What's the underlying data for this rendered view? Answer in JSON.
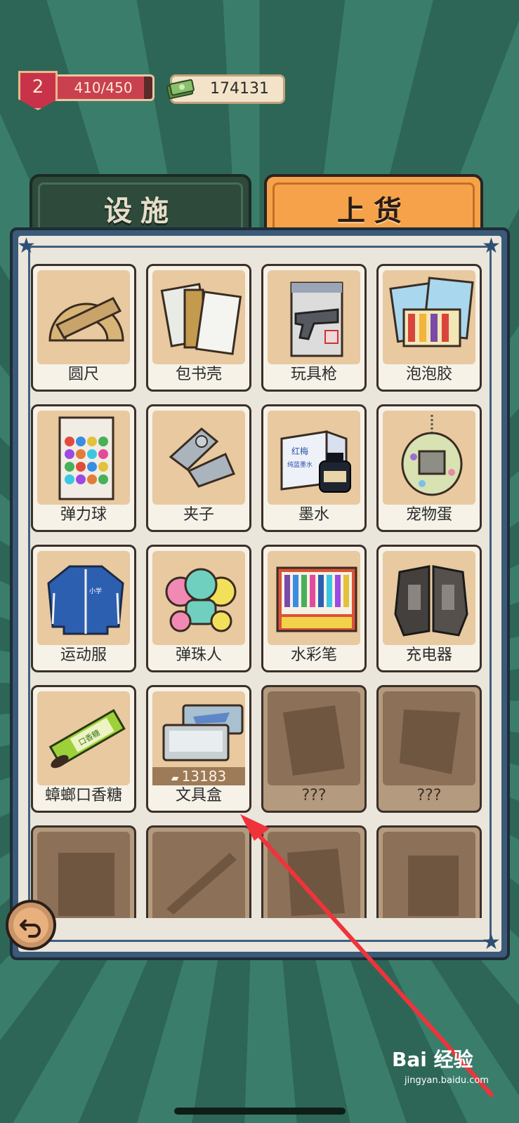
{
  "player": {
    "level": "2",
    "xp_text": "410/450",
    "xp_progress": 0.911,
    "cash": "174131"
  },
  "tabs": [
    {
      "label": "设施",
      "active": false
    },
    {
      "label": "上货",
      "active": true
    }
  ],
  "items": [
    {
      "name": "圆尺"
    },
    {
      "name": "包书壳"
    },
    {
      "name": "玩具枪"
    },
    {
      "name": "泡泡胶"
    },
    {
      "name": "弹力球"
    },
    {
      "name": "夹子"
    },
    {
      "name": "墨水"
    },
    {
      "name": "宠物蛋"
    },
    {
      "name": "运动服"
    },
    {
      "name": "弹珠人"
    },
    {
      "name": "水彩笔"
    },
    {
      "name": "充电器"
    },
    {
      "name": "蟑螂口香糖"
    },
    {
      "name": "文具盒",
      "price": "13183"
    },
    {
      "name": "???"
    },
    {
      "name": "???"
    }
  ],
  "item_art": {
    "0": {
      "label": "",
      "sub": ""
    },
    "2": {
      "label": "",
      "sub": ""
    },
    "6": {
      "label": "红梅",
      "sub": "纯蓝墨水"
    },
    "8": {
      "label": "小学"
    },
    "12": {
      "label": "口香糖"
    }
  },
  "watermark": {
    "brand": "Bai 经验",
    "url": "jingyan.baidu.com"
  },
  "colors": {
    "background": "#2f6b5c",
    "tab_active": "#f5a24a",
    "tab_inactive": "#2d4a3b",
    "panel_border": "#3a5a78",
    "card_art": "#e8c9a0",
    "arrow": "#f0333a"
  }
}
